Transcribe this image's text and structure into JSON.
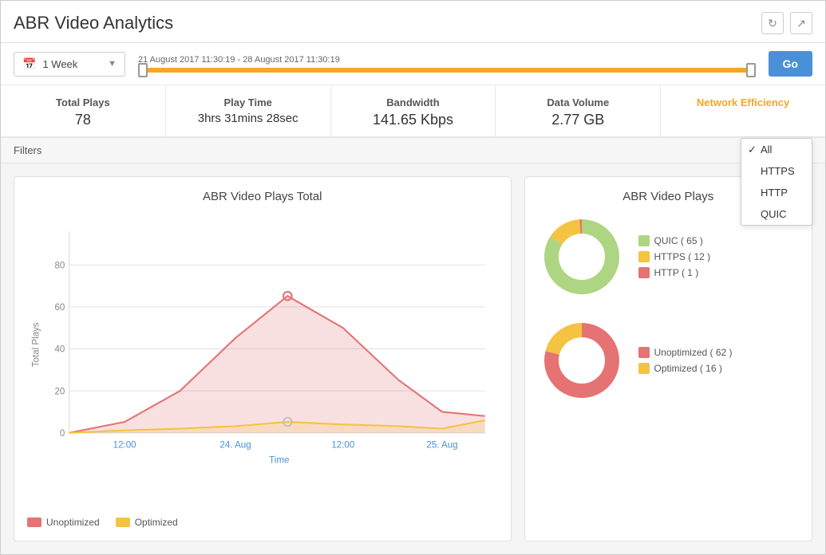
{
  "window": {
    "title": "ABR Video Analytics"
  },
  "toolbar": {
    "date_range_label": "21 August 2017 11:30:19 - 28 August 2017 11:30:19",
    "period_select": "1 Week",
    "go_button": "Go"
  },
  "metrics": [
    {
      "label": "Total Plays",
      "value": "78",
      "active": false
    },
    {
      "label": "Play Time",
      "value": "3hrs 31mins 28sec",
      "active": false
    },
    {
      "label": "Bandwidth",
      "value": "141.65 Kbps",
      "active": false
    },
    {
      "label": "Data Volume",
      "value": "2.77 GB",
      "active": false
    },
    {
      "label": "Network Efficiency",
      "value": "",
      "active": true
    }
  ],
  "filters": {
    "label": "Filters",
    "dropdown": {
      "options": [
        {
          "label": "All",
          "checked": true
        },
        {
          "label": "HTTPS",
          "checked": false
        },
        {
          "label": "HTTP",
          "checked": false
        },
        {
          "label": "QUIC",
          "checked": false
        }
      ]
    }
  },
  "line_chart": {
    "title": "ABR Video Plays Total",
    "y_label": "Total Plays",
    "x_label": "Time",
    "y_ticks": [
      "0",
      "20",
      "40",
      "60",
      "80"
    ],
    "x_ticks": [
      "12:00",
      "24. Aug",
      "12:00",
      "25. Aug"
    ],
    "legend": [
      {
        "label": "Unoptimized",
        "color": "#e57373"
      },
      {
        "label": "Optimized",
        "color": "#f5c342"
      }
    ],
    "unoptimized_data": [
      0,
      5,
      20,
      45,
      65,
      50,
      25,
      10,
      8
    ],
    "optimized_data": [
      0,
      1,
      2,
      3,
      5,
      4,
      3,
      2,
      6
    ]
  },
  "pie_chart": {
    "title": "ABR Video Plays",
    "protocol_legend": [
      {
        "label": "QUIC ( 65 )",
        "color": "#aed581"
      },
      {
        "label": "HTTPS ( 12 )",
        "color": "#f5c342"
      },
      {
        "label": "HTTP ( 1 )",
        "color": "#e57373"
      }
    ],
    "protocol_slices": [
      {
        "label": "QUIC",
        "value": 65,
        "color": "#aed581",
        "percent": 84
      },
      {
        "label": "HTTPS",
        "value": 12,
        "color": "#f5c342",
        "percent": 15
      },
      {
        "label": "HTTP",
        "value": 1,
        "color": "#e57373",
        "percent": 1
      }
    ],
    "optim_legend": [
      {
        "label": "Unoptimized ( 62 )",
        "color": "#e57373"
      },
      {
        "label": "Optimized ( 16 )",
        "color": "#f5c342"
      }
    ],
    "optim_slices": [
      {
        "label": "Unoptimized",
        "value": 62,
        "color": "#e57373",
        "percent": 79
      },
      {
        "label": "Optimized",
        "value": 16,
        "color": "#f5c342",
        "percent": 21
      }
    ]
  },
  "icons": {
    "calendar": "📅",
    "refresh": "↻",
    "export": "↗"
  }
}
